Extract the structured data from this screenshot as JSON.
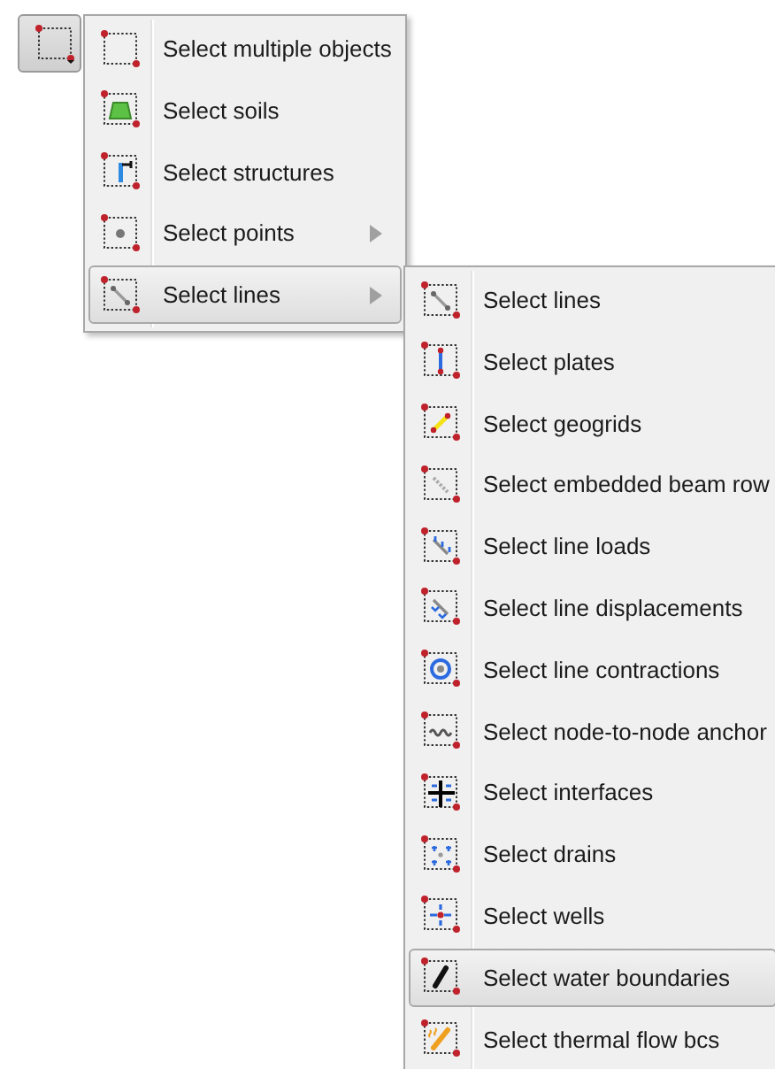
{
  "toolbar_button": {
    "selected": true
  },
  "menu": {
    "items": [
      {
        "label": "Select multiple objects",
        "selected": false,
        "has_submenu": false
      },
      {
        "label": "Select soils",
        "selected": false,
        "has_submenu": false
      },
      {
        "label": "Select structures",
        "selected": false,
        "has_submenu": false
      },
      {
        "label": "Select points",
        "selected": false,
        "has_submenu": true
      },
      {
        "label": "Select lines",
        "selected": true,
        "has_submenu": true
      }
    ]
  },
  "submenu": {
    "items": [
      {
        "label": "Select lines",
        "selected": false
      },
      {
        "label": "Select plates",
        "selected": false
      },
      {
        "label": "Select geogrids",
        "selected": false
      },
      {
        "label": "Select embedded beam row",
        "selected": false
      },
      {
        "label": "Select line loads",
        "selected": false
      },
      {
        "label": "Select line displacements",
        "selected": false
      },
      {
        "label": "Select line contractions",
        "selected": false
      },
      {
        "label": "Select node-to-node anchor",
        "selected": false
      },
      {
        "label": "Select interfaces",
        "selected": false
      },
      {
        "label": "Select drains",
        "selected": false
      },
      {
        "label": "Select wells",
        "selected": false
      },
      {
        "label": "Select water boundaries",
        "selected": true
      },
      {
        "label": "Select thermal flow bcs",
        "selected": false
      }
    ]
  }
}
